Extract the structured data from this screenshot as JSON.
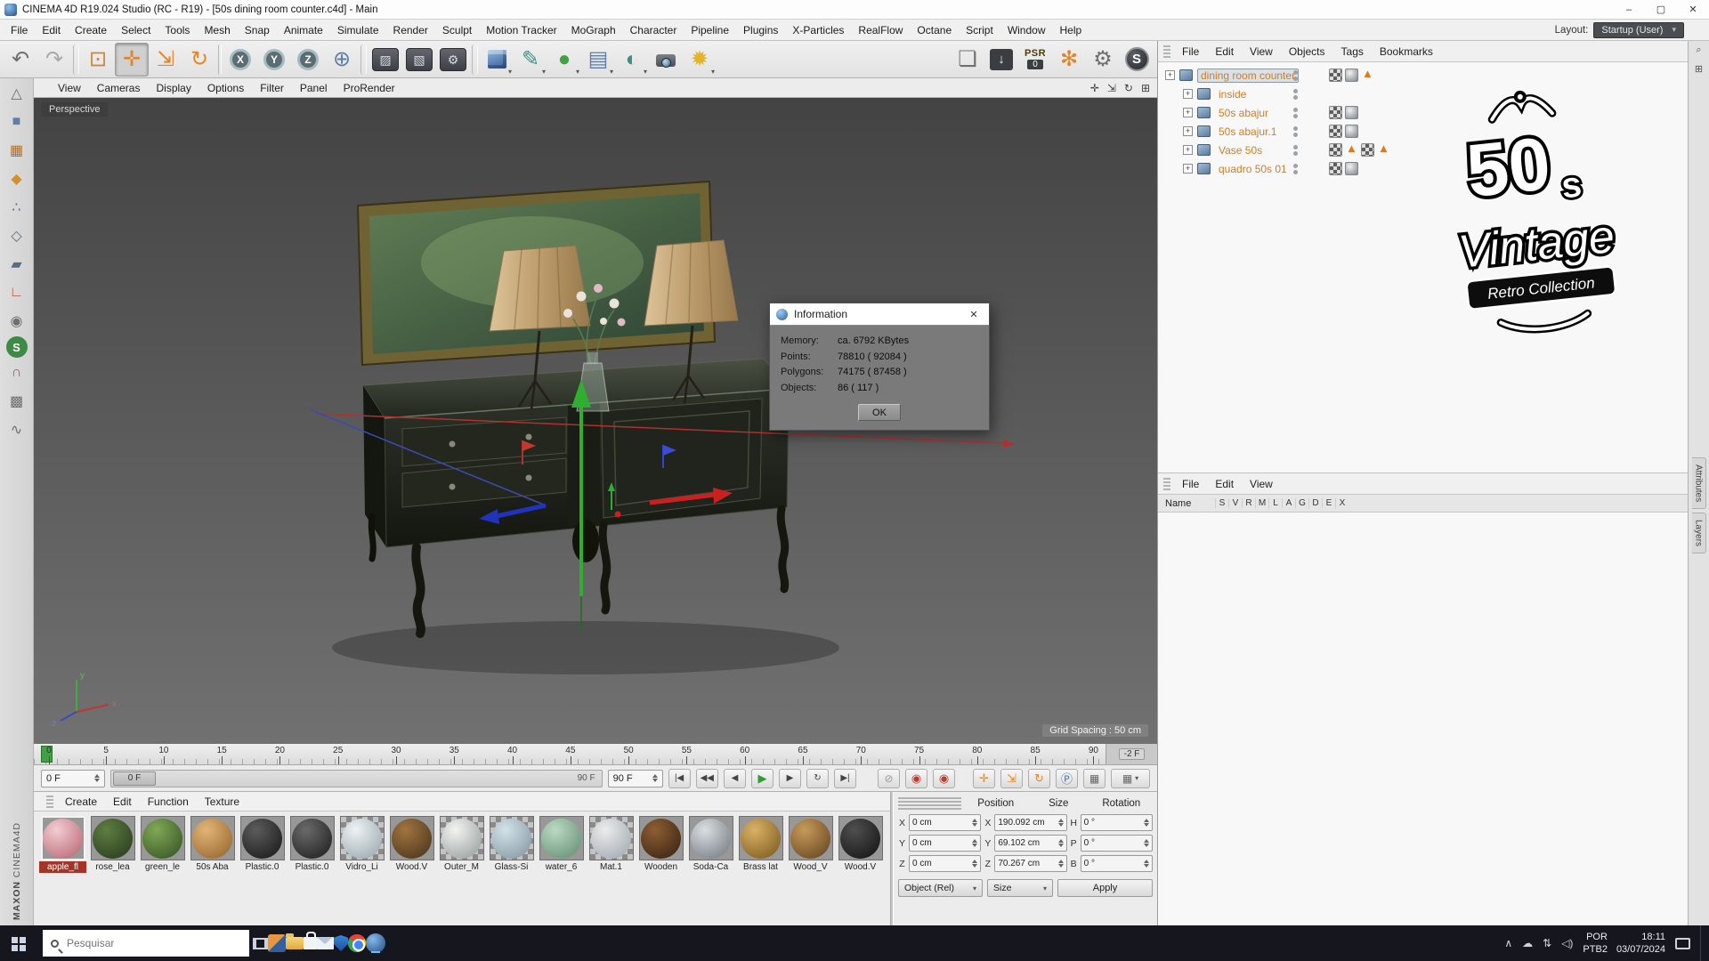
{
  "titlebar": {
    "title": "CINEMA 4D R19.024 Studio (RC - R19) - [50s dining room counter.c4d] - Main",
    "minimize": "–",
    "maximize": "▢",
    "close": "✕"
  },
  "menubar": {
    "items": [
      "File",
      "Edit",
      "Create",
      "Select",
      "Tools",
      "Mesh",
      "Snap",
      "Animate",
      "Simulate",
      "Render",
      "Sculpt",
      "Motion Tracker",
      "MoGraph",
      "Character",
      "Pipeline",
      "Plugins",
      "X-Particles",
      "RealFlow",
      "Octane",
      "Script",
      "Window",
      "Help"
    ],
    "layout_label": "Layout:",
    "layout_value": "Startup (User)"
  },
  "toolbar": {
    "items": [
      {
        "dn": "undo-button",
        "g": "↶",
        "cls": "c-mid big"
      },
      {
        "dn": "redo-button",
        "g": "↷",
        "cls": "c-lt big"
      },
      {
        "dn": "toolbar-separator",
        "cls": "sep"
      },
      {
        "dn": "live-selection-tool",
        "g": "⊡",
        "cls": "c-sel big"
      },
      {
        "dn": "move-tool",
        "g": "✛",
        "cls": "c-or big pressed"
      },
      {
        "dn": "scale-tool",
        "g": "⇲",
        "cls": "c-or big"
      },
      {
        "dn": "rotate-tool",
        "g": "↻",
        "cls": "c-or big"
      },
      {
        "dn": "toolbar-separator",
        "cls": "sep thin"
      },
      {
        "dn": "x-axis-button",
        "g": "X",
        "cls": "xyz"
      },
      {
        "dn": "y-axis-button",
        "g": "Y",
        "cls": "xyz"
      },
      {
        "dn": "z-axis-button",
        "g": "Z",
        "cls": "xyz"
      },
      {
        "dn": "coordinate-system-button",
        "g": "⊕",
        "cls": "c-bl big"
      },
      {
        "dn": "toolbar-separator",
        "cls": "sep"
      },
      {
        "dn": "render-view-button",
        "g": "▨",
        "cls": "dark"
      },
      {
        "dn": "render-picture-viewer-button",
        "g": "▧",
        "cls": "dark"
      },
      {
        "dn": "render-settings-button",
        "g": "⚙",
        "cls": "dark"
      },
      {
        "dn": "toolbar-separator",
        "cls": "sep"
      },
      {
        "dn": "primitive-cube-button",
        "g": "",
        "cls": "ico-cube dd"
      },
      {
        "dn": "spline-pen-button",
        "g": "✎",
        "cls": "c-teal big dd"
      },
      {
        "dn": "subdivision-surface-button",
        "g": "●",
        "cls": "c-green big dd"
      },
      {
        "dn": "deformer-button",
        "g": "▤",
        "cls": "c-bl big dd"
      },
      {
        "dn": "environment-button",
        "g": "◐",
        "cls": "c-teal big dd"
      },
      {
        "dn": "camera-button",
        "g": "",
        "cls": "ico-cam dd"
      },
      {
        "dn": "light-button",
        "g": "✹",
        "cls": "c-yel big dd"
      }
    ],
    "right": [
      {
        "dn": "layout-panel-button",
        "g": "❏",
        "cls": "c-mid big"
      },
      {
        "dn": "render-queue-button",
        "g": "↓",
        "cls": "darkchip"
      },
      {
        "dn": "psr-display",
        "g": "PSR",
        "sub": "0",
        "cls": "psr"
      },
      {
        "dn": "mograph-button",
        "g": "✻",
        "cls": "c-or big"
      },
      {
        "dn": "preferences-gear-button",
        "g": "⚙",
        "cls": "c-mid big"
      },
      {
        "dn": "s-plugin-badge",
        "g": "S",
        "cls": "sbadge"
      }
    ]
  },
  "left_strip": {
    "items": [
      {
        "dn": "make-editable-button",
        "g": "△",
        "cls": "ls-gray"
      },
      {
        "dn": "model-mode-button",
        "g": "■",
        "cls": "ls-blue"
      },
      {
        "dn": "texture-mode-button",
        "g": "▦",
        "cls": "ls-brown"
      },
      {
        "dn": "workplane-mode-button",
        "g": "◆",
        "cls": "ls-orange"
      },
      {
        "dn": "points-mode-button",
        "g": "∴",
        "cls": "ls-slate"
      },
      {
        "dn": "edges-mode-button",
        "g": "◇",
        "cls": "ls-slate"
      },
      {
        "dn": "polygons-mode-button",
        "g": "▰",
        "cls": "ls-slate"
      },
      {
        "dn": "axis-mode-button",
        "g": "∟",
        "cls": "ls-red"
      },
      {
        "dn": "viewport-solo-button",
        "g": "◉",
        "cls": "ls-gray"
      },
      {
        "dn": "snap-button",
        "g": "S",
        "cls": "ls-snap"
      },
      {
        "dn": "magnet-button",
        "g": "∩",
        "cls": "ls-red"
      },
      {
        "dn": "lock-workplane-button",
        "g": "▩",
        "cls": "ls-gray"
      },
      {
        "dn": "quantize-button",
        "g": "∿",
        "cls": "ls-gray"
      }
    ]
  },
  "viewport": {
    "menus": [
      "View",
      "Cameras",
      "Display",
      "Options",
      "Filter",
      "Panel",
      "ProRender"
    ],
    "corner_tools": [
      {
        "dn": "pan-view-icon",
        "g": "✛"
      },
      {
        "dn": "zoom-view-icon",
        "g": "⇲"
      },
      {
        "dn": "rotate-view-icon",
        "g": "↻"
      },
      {
        "dn": "toggle-views-icon",
        "g": "⊞"
      }
    ],
    "camera_label": "Perspective",
    "grid_spacing": "Grid Spacing : 50 cm",
    "axis": {
      "x": "x",
      "y": "y",
      "z": "z"
    }
  },
  "dialog": {
    "title": "Information",
    "rows": [
      {
        "label": "Memory:",
        "value": "ca. 6792 KBytes"
      },
      {
        "label": "Points:",
        "value": "78810 ( 92084 )"
      },
      {
        "label": "Polygons:",
        "value": "74175 ( 87458 )"
      },
      {
        "label": "Objects:",
        "value": "86 ( 117 )"
      }
    ],
    "ok_label": "OK",
    "close": "✕"
  },
  "object_manager": {
    "menus": [
      "File",
      "Edit",
      "View",
      "Objects",
      "Tags",
      "Bookmarks"
    ],
    "objects": [
      {
        "name": "dining room counter",
        "selected": true,
        "cls": "lvl0",
        "tags": [
          "tex",
          "phong",
          "warn"
        ]
      },
      {
        "name": "inside",
        "cls": "lvl1",
        "tags": []
      },
      {
        "name": "50s abajur",
        "cls": "lvl1",
        "tags": [
          "tex",
          "phong"
        ]
      },
      {
        "name": "50s abajur.1",
        "cls": "lvl1",
        "tags": [
          "tex",
          "phong"
        ]
      },
      {
        "name": "Vase 50s",
        "cls": "lvl1",
        "tags": [
          "tex",
          "warn",
          "tex",
          "warn"
        ]
      },
      {
        "name": "quadro 50s 01",
        "cls": "lvl1",
        "tags": [
          "tex",
          "phong"
        ]
      }
    ]
  },
  "layers_panel": {
    "menus": [
      "File",
      "Edit",
      "View"
    ],
    "name_label": "Name",
    "letters": [
      "S",
      "V",
      "R",
      "M",
      "L",
      "A",
      "G",
      "D",
      "E",
      "X"
    ]
  },
  "side_strip": {
    "icons": [
      {
        "dn": "panel-search-icon",
        "g": "⌕"
      },
      {
        "dn": "panel-dock-icon",
        "g": "⊞"
      }
    ],
    "tabs": [
      {
        "label": "Attributes"
      },
      {
        "label": "Layers"
      }
    ]
  },
  "timeline": {
    "ticks": [
      "0",
      "5",
      "10",
      "15",
      "20",
      "25",
      "30",
      "35",
      "40",
      "45",
      "50",
      "55",
      "60",
      "65",
      "70",
      "75",
      "80",
      "85",
      "90"
    ],
    "end_label": "-2 F"
  },
  "transport": {
    "current": "0 F",
    "slider_start": "0 F",
    "slider_end": "90 F",
    "max": "90 F",
    "buttons": [
      {
        "dn": "goto-start-button",
        "g": "|◀"
      },
      {
        "dn": "prev-key-button",
        "g": "◀◀"
      },
      {
        "dn": "prev-frame-button",
        "g": "◀"
      },
      {
        "dn": "play-button",
        "g": "▶",
        "cls": "c-green"
      },
      {
        "dn": "next-frame-button",
        "g": "▶"
      },
      {
        "dn": "loop-button",
        "g": "↻"
      },
      {
        "dn": "goto-end-button",
        "g": "▶|"
      },
      {
        "dn": "transport-gap",
        "cls": "gap"
      },
      {
        "dn": "record-off-button",
        "g": "⊘",
        "cls": "c-lt"
      },
      {
        "dn": "record-keyframe-button",
        "g": "◉",
        "cls": "c-red"
      },
      {
        "dn": "autokey-button",
        "g": "◉",
        "cls": "c-red"
      },
      {
        "dn": "transport-gap",
        "cls": "gap sm"
      },
      {
        "dn": "record-position-button",
        "g": "✛",
        "cls": "c-or"
      },
      {
        "dn": "record-scale-button",
        "g": "⇲",
        "cls": "c-or"
      },
      {
        "dn": "record-rotation-button",
        "g": "↻",
        "cls": "c-or"
      },
      {
        "dn": "record-parameter-button",
        "g": "Ⓟ",
        "cls": "c-bl"
      },
      {
        "dn": "record-pla-button",
        "g": "▦",
        "cls": "c-mid"
      },
      {
        "dn": "keyframe-selection-button",
        "g": "▦",
        "cls": "c-mid dd wide"
      }
    ]
  },
  "materials": {
    "menus": [
      "Create",
      "Edit",
      "Function",
      "Texture"
    ],
    "items": [
      {
        "name": "apple_fl",
        "selected": true,
        "c1": "#f2cdd2",
        "c2": "#b5606e"
      },
      {
        "name": "rose_lea",
        "c1": "#5f7d42",
        "c2": "#25371b"
      },
      {
        "name": "green_le",
        "c1": "#7fa855",
        "c2": "#324f22"
      },
      {
        "name": "50s Aba",
        "c1": "#e2b476",
        "c2": "#8f6128"
      },
      {
        "name": "Plastic.0",
        "c1": "#5c5c5c",
        "c2": "#151515"
      },
      {
        "name": "Plastic.0",
        "c1": "#6a6a6a",
        "c2": "#1a1a1a"
      },
      {
        "name": "Vidro_Li",
        "cls": "checker",
        "c1": "#eef2f4",
        "c2": "#93a2aa"
      },
      {
        "name": "Wood.V",
        "c1": "#a0743f",
        "c2": "#46301a"
      },
      {
        "name": "Outer_M",
        "cls": "checker",
        "c1": "#f4f4f2",
        "c2": "#8e9896"
      },
      {
        "name": "Glass-Si",
        "cls": "checker",
        "c1": "#d3e2e9",
        "c2": "#7e929c"
      },
      {
        "name": "water_6",
        "c1": "#bcd9c3",
        "c2": "#5d8a6d"
      },
      {
        "name": "Mat.1",
        "cls": "checker",
        "c1": "#ececec",
        "c2": "#9aa4ac"
      },
      {
        "name": "Wooden",
        "c1": "#8d5e35",
        "c2": "#341f0e"
      },
      {
        "name": "Soda-Ca",
        "c1": "#dadee2",
        "c2": "#6d757b"
      },
      {
        "name": "Brass lat",
        "c1": "#d9b264",
        "c2": "#76541b"
      },
      {
        "name": "Wood_V",
        "c1": "#c79a59",
        "c2": "#5e3f1d"
      },
      {
        "name": "Wood.V",
        "c1": "#4f4f4f",
        "c2": "#101010"
      }
    ]
  },
  "coordinates": {
    "headers": [
      "Position",
      "Size",
      "Rotation"
    ],
    "rows": [
      {
        "a1": "X",
        "v1": "0 cm",
        "a2": "X",
        "v2": "190.092 cm",
        "a3": "H",
        "v3": "0 °"
      },
      {
        "a1": "Y",
        "v1": "0 cm",
        "a2": "Y",
        "v2": "69.102 cm",
        "a3": "P",
        "v3": "0 °"
      },
      {
        "a1": "Z",
        "v1": "0 cm",
        "a2": "Z",
        "v2": "70.267 cm",
        "a3": "B",
        "v3": "0 °"
      }
    ],
    "mode_object": "Object (Rel)",
    "mode_size": "Size",
    "apply_label": "Apply"
  },
  "branding": {
    "maxon": "MAXON",
    "c4d": "CINEMA4D"
  },
  "logo": {
    "big": "50",
    "small_s": "s",
    "script": "Vintage",
    "banner": "Retro Collection"
  },
  "taskbar": {
    "search_placeholder": "Pesquisar",
    "apps": [
      {
        "dn": "task-view-button",
        "cls": "i-tv"
      },
      {
        "dn": "installer-app-button",
        "cls": "i-inst"
      },
      {
        "dn": "file-explorer-button",
        "cls": "i-folder"
      },
      {
        "dn": "store-app-button",
        "cls": "i-store"
      },
      {
        "dn": "mail-app-button",
        "cls": "i-mail"
      },
      {
        "dn": "defender-app-button",
        "cls": "i-shield"
      },
      {
        "dn": "chrome-app-button",
        "cls": "i-chrome"
      },
      {
        "dn": "cinema4d-app-button",
        "cls": "i-c4d",
        "active": true
      }
    ],
    "tray_icons": [
      {
        "dn": "tray-chevron-icon",
        "g": "∧"
      },
      {
        "dn": "onedrive-icon",
        "g": "☁"
      },
      {
        "dn": "network-icon",
        "g": "⇅"
      },
      {
        "dn": "volume-icon",
        "g": "◁)"
      }
    ],
    "tray": {
      "lang_top": "POR",
      "lang_bottom": "PTB2",
      "time": "18:11",
      "date": "03/07/2024"
    }
  }
}
